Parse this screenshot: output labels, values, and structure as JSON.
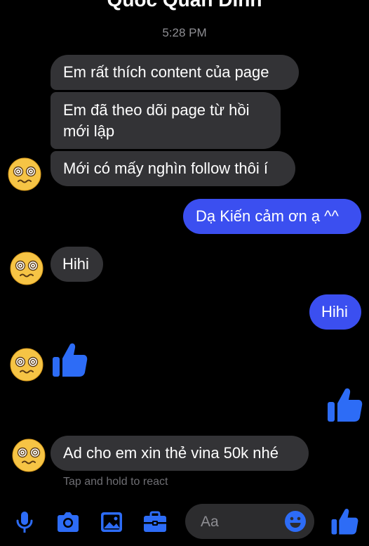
{
  "header": {
    "title": "Quoc Quan Dinh"
  },
  "thread": {
    "timestamp": "5:28 PM",
    "messages": [
      {
        "from": "them",
        "text": "Em rất thích content của page"
      },
      {
        "from": "them",
        "text": "Em đã theo dõi page từ hồi mới lập"
      },
      {
        "from": "them",
        "text": "Mới có mấy nghìn follow thôi í"
      },
      {
        "from": "me",
        "text": "Dạ Kiến cảm ơn ạ ^^"
      },
      {
        "from": "them",
        "text": "Hihi"
      },
      {
        "from": "me",
        "text": "Hihi"
      },
      {
        "from": "them",
        "type": "like"
      },
      {
        "from": "me",
        "type": "like"
      },
      {
        "from": "them",
        "text": "Ad cho em xin thẻ vina 50k nhé"
      }
    ],
    "react_hint": "Tap and hold to react"
  },
  "composer": {
    "placeholder": "Aa"
  },
  "icons": [
    "microphone-icon",
    "camera-icon",
    "gallery-icon",
    "toolbox-icon",
    "emoji-icon",
    "thumbs-up-icon"
  ],
  "colors": {
    "accent": "#3b4ff0",
    "incoming_bubble": "#333336",
    "icon_blue": "#2d6cf6",
    "background": "#000000"
  }
}
